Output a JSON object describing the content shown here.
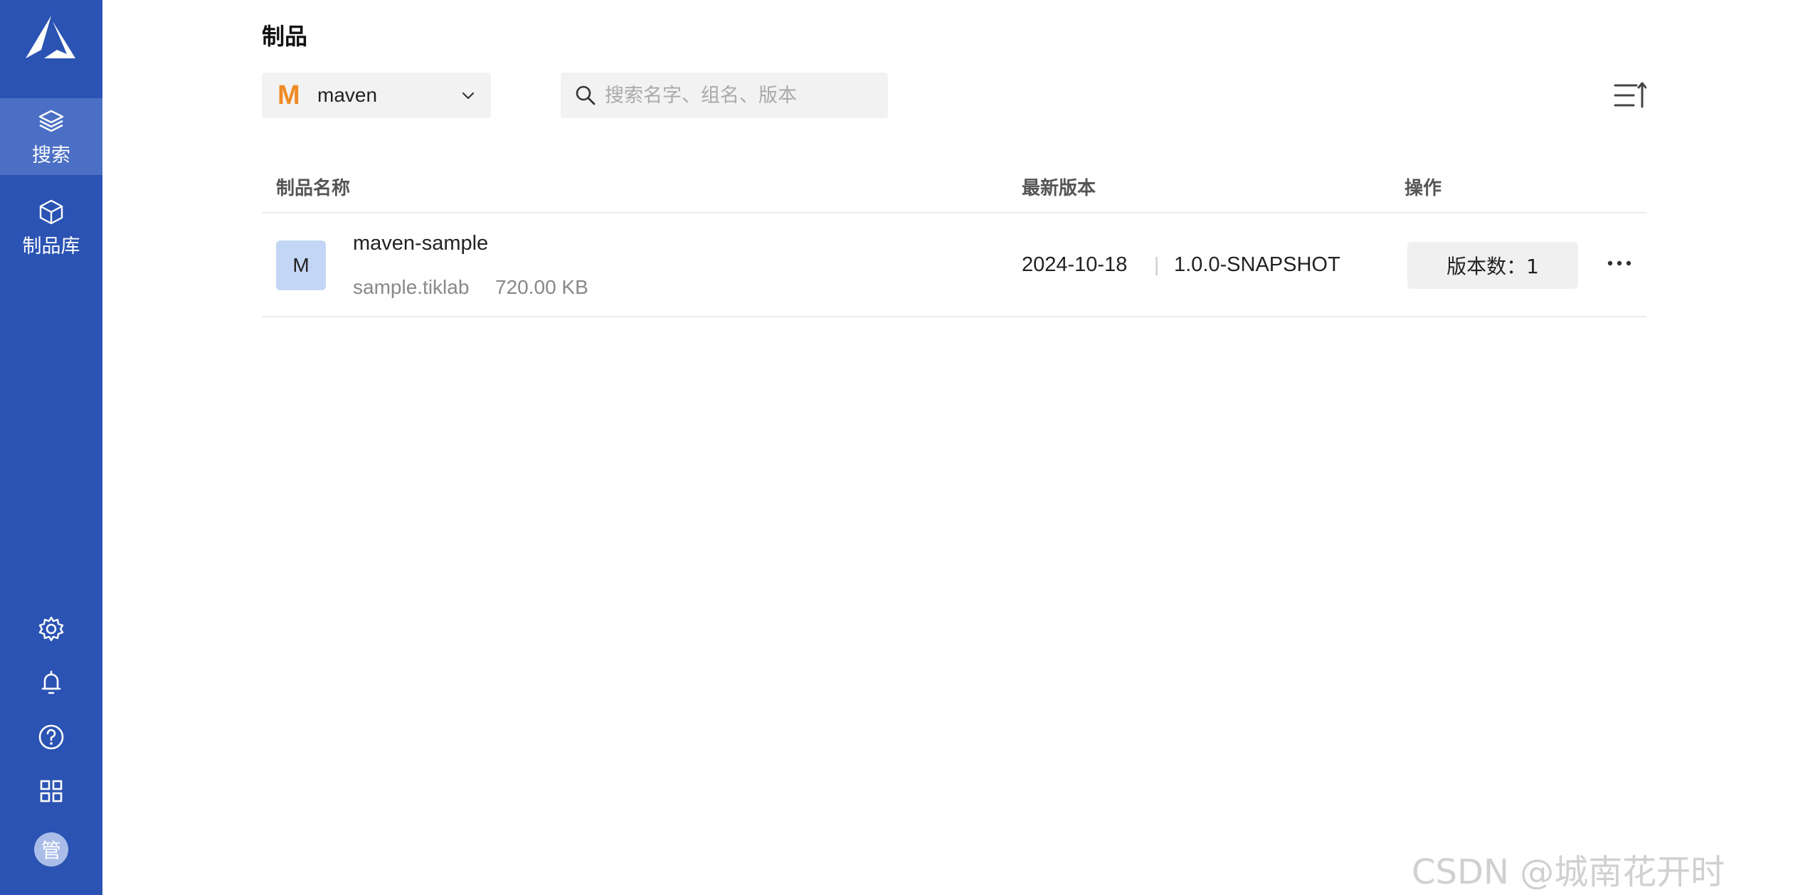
{
  "sidebar": {
    "nav": [
      {
        "label": "搜索",
        "icon": "layers-icon",
        "active": true
      },
      {
        "label": "制品库",
        "icon": "cube-icon",
        "active": false
      }
    ],
    "bottom_icons": [
      "gear-icon",
      "bell-icon",
      "help-icon",
      "apps-grid-icon"
    ],
    "avatar_text": "管",
    "colors": {
      "background": "#2b53b3",
      "active": "#4a6fc4"
    }
  },
  "header": {
    "title": "制品",
    "repo_select": {
      "value": "maven",
      "icon_text": "M"
    },
    "search": {
      "placeholder": "搜索名字、组名、版本",
      "value": ""
    }
  },
  "table": {
    "columns": [
      "制品名称",
      "最新版本",
      "操作"
    ],
    "rows": [
      {
        "avatar": "M",
        "name": "maven-sample",
        "group": "sample.tiklab",
        "size": "720.00 KB",
        "date": "2024-10-18",
        "separator": "|",
        "version": "1.0.0-SNAPSHOT",
        "version_count_label": "版本数：1"
      }
    ]
  },
  "watermark": "CSDN @城南花开时"
}
